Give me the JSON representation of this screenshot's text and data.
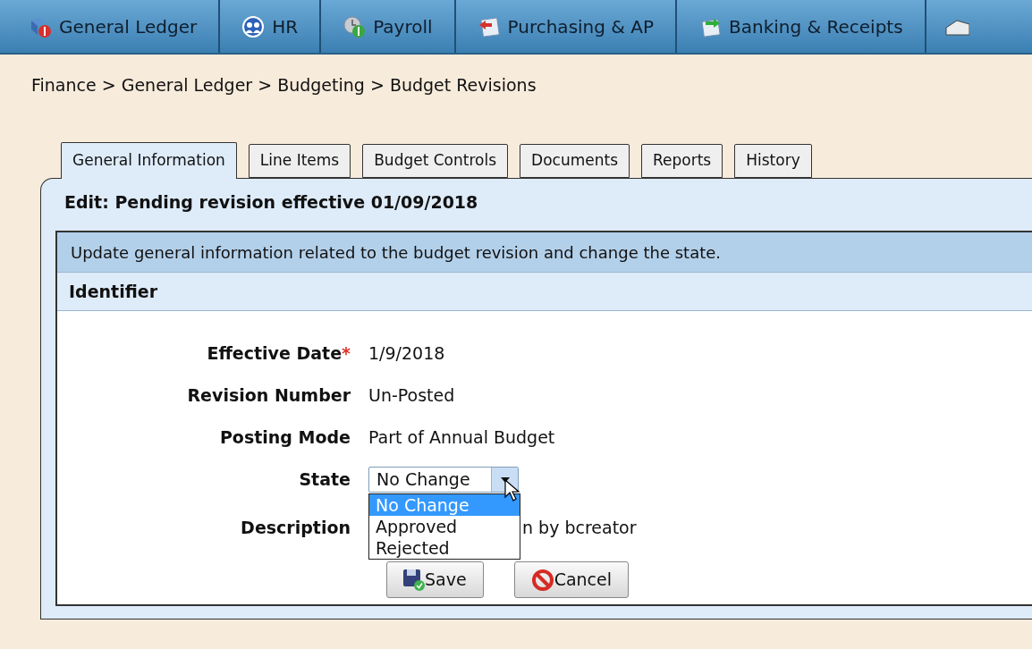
{
  "nav_tabs": [
    {
      "label": "General Ledger"
    },
    {
      "label": "HR"
    },
    {
      "label": "Payroll"
    },
    {
      "label": "Purchasing & AP"
    },
    {
      "label": "Banking & Receipts"
    }
  ],
  "breadcrumb": "Finance > General Ledger > Budgeting > Budget Revisions",
  "tabs": [
    {
      "label": "General Information",
      "selected": true
    },
    {
      "label": "Line Items",
      "selected": false
    },
    {
      "label": "Budget Controls",
      "selected": false
    },
    {
      "label": "Documents",
      "selected": false
    },
    {
      "label": "Reports",
      "selected": false
    },
    {
      "label": "History",
      "selected": false
    }
  ],
  "panel_title": "Edit: Pending revision effective 01/09/2018",
  "instructions": "Update general information related to the budget revision and change the state.",
  "section": "Identifier",
  "fields": [
    {
      "kind": "text",
      "label": "Effective Date",
      "required": true,
      "value": "1/9/2018"
    },
    {
      "kind": "text",
      "label": "Revision Number",
      "required": false,
      "value": "Un-Posted"
    },
    {
      "kind": "text",
      "label": "Posting Mode",
      "required": false,
      "value": "Part of Annual Budget"
    },
    {
      "kind": "select",
      "label": "State",
      "required": false,
      "value": "No Change",
      "expanded": true,
      "options": [
        {
          "label": "No Change",
          "selected": true
        },
        {
          "label": "Approved",
          "selected": false
        },
        {
          "label": "Rejected",
          "selected": false
        }
      ]
    },
    {
      "kind": "covered",
      "label": "Description",
      "required": false,
      "value": "n by bcreator"
    }
  ],
  "required_mark": "*",
  "buttons": [
    {
      "kind": "save",
      "label": "Save"
    },
    {
      "kind": "cancel",
      "label": "Cancel"
    }
  ]
}
